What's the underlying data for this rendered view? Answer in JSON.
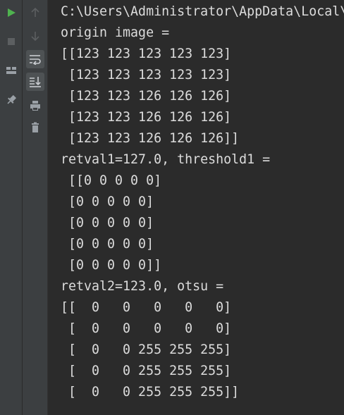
{
  "toolbar": {
    "run": {
      "icon": "play-icon",
      "color": "#4fb34f"
    },
    "stop": {
      "icon": "stop-icon"
    },
    "layout": {
      "icon": "layout-icon"
    },
    "pin": {
      "icon": "pin-icon"
    },
    "up": {
      "icon": "arrow-up-icon"
    },
    "down": {
      "icon": "arrow-down-icon"
    },
    "wrap": {
      "icon": "soft-wrap-icon"
    },
    "scroll": {
      "icon": "scroll-to-end-icon"
    },
    "print": {
      "icon": "print-icon"
    },
    "trash": {
      "icon": "trash-icon"
    }
  },
  "console": {
    "lines": [
      "C:\\Users\\Administrator\\AppData\\Local\\",
      "origin image =",
      "[[123 123 123 123 123]",
      " [123 123 123 123 123]",
      " [123 123 126 126 126]",
      " [123 123 126 126 126]",
      " [123 123 126 126 126]]",
      "retval1=127.0, threshold1 =",
      " [[0 0 0 0 0]",
      " [0 0 0 0 0]",
      " [0 0 0 0 0]",
      " [0 0 0 0 0]",
      " [0 0 0 0 0]]",
      "retval2=123.0, otsu =",
      "[[  0   0   0   0   0]",
      " [  0   0   0   0   0]",
      " [  0   0 255 255 255]",
      " [  0   0 255 255 255]",
      " [  0   0 255 255 255]]"
    ]
  }
}
